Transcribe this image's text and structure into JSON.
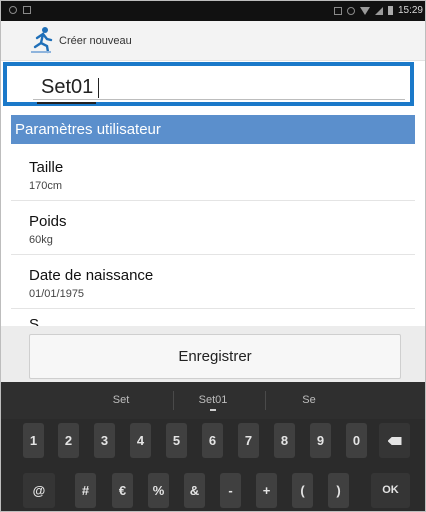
{
  "status_bar": {
    "time": "15:29",
    "icons": [
      "notification-icon",
      "screenshot-icon",
      "nfc-icon",
      "no-sim-icon",
      "wifi-icon",
      "signal-icon",
      "battery-icon"
    ]
  },
  "action_bar": {
    "title": "Créer nouveau",
    "app_icon": "runner-icon"
  },
  "name_field": {
    "value": "Set01"
  },
  "section_header": "Paramètres utilisateur",
  "settings": [
    {
      "label": "Taille",
      "value": "170cm"
    },
    {
      "label": "Poids",
      "value": "60kg"
    },
    {
      "label": "Date de naissance",
      "value": "01/01/1975"
    },
    {
      "label": "S",
      "value": ""
    }
  ],
  "save_button": "Enregistrer",
  "keyboard": {
    "suggestions": [
      "Set",
      "Set01",
      "Se"
    ],
    "row1": [
      "1",
      "2",
      "3",
      "4",
      "5",
      "6",
      "7",
      "8",
      "9",
      "0"
    ],
    "row2": [
      "@",
      "#",
      "€",
      "%",
      "&",
      "-",
      "+",
      "(",
      ")"
    ],
    "ok_label": "OK",
    "backspace_icon": "backspace-icon"
  },
  "colors": {
    "accent_border": "#1b79c9",
    "section_header": "#5b8fcc",
    "keyboard_bg": "#2b2b2b"
  }
}
